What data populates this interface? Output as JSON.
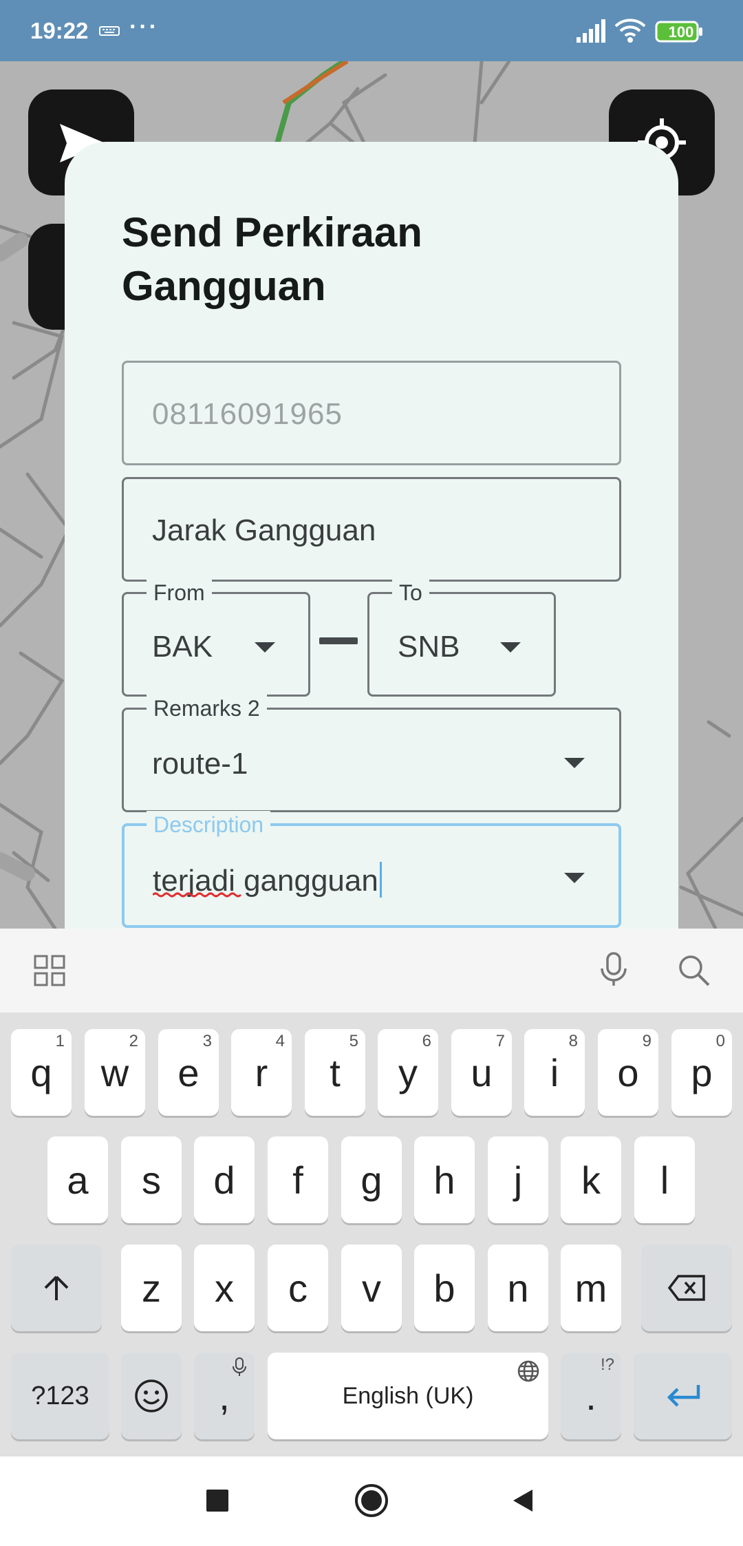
{
  "status_bar": {
    "time": "19:22",
    "dots": "···",
    "battery": "100"
  },
  "dialog": {
    "title": "Send Perkiraan Gangguan",
    "phone_field": {
      "value": "08116091965"
    },
    "distance_field": {
      "placeholder": "Jarak Gangguan"
    },
    "from_field": {
      "label": "From",
      "value": "BAK"
    },
    "to_field": {
      "label": "To",
      "value": "SNB"
    },
    "remarks_field": {
      "label": "Remarks 2",
      "value": "route-1"
    },
    "description_field": {
      "label": "Description",
      "value": "terjadi gangguan"
    }
  },
  "keyboard": {
    "row1": [
      {
        "key": "q",
        "hint": "1"
      },
      {
        "key": "w",
        "hint": "2"
      },
      {
        "key": "e",
        "hint": "3"
      },
      {
        "key": "r",
        "hint": "4"
      },
      {
        "key": "t",
        "hint": "5"
      },
      {
        "key": "y",
        "hint": "6"
      },
      {
        "key": "u",
        "hint": "7"
      },
      {
        "key": "i",
        "hint": "8"
      },
      {
        "key": "o",
        "hint": "9"
      },
      {
        "key": "p",
        "hint": "0"
      }
    ],
    "row2": [
      "a",
      "s",
      "d",
      "f",
      "g",
      "h",
      "j",
      "k",
      "l"
    ],
    "row3": [
      "z",
      "x",
      "c",
      "v",
      "b",
      "n",
      "m"
    ],
    "symbols_label": "?123",
    "comma": ",",
    "period": ".",
    "period_hint": "!?",
    "space_label": "English (UK)"
  },
  "colors": {
    "status_bar": "#5f8fb6",
    "dialog_bg": "#edf6f3",
    "focus_accent": "#8ec9ee",
    "enter_key": "#2a8ad0"
  }
}
